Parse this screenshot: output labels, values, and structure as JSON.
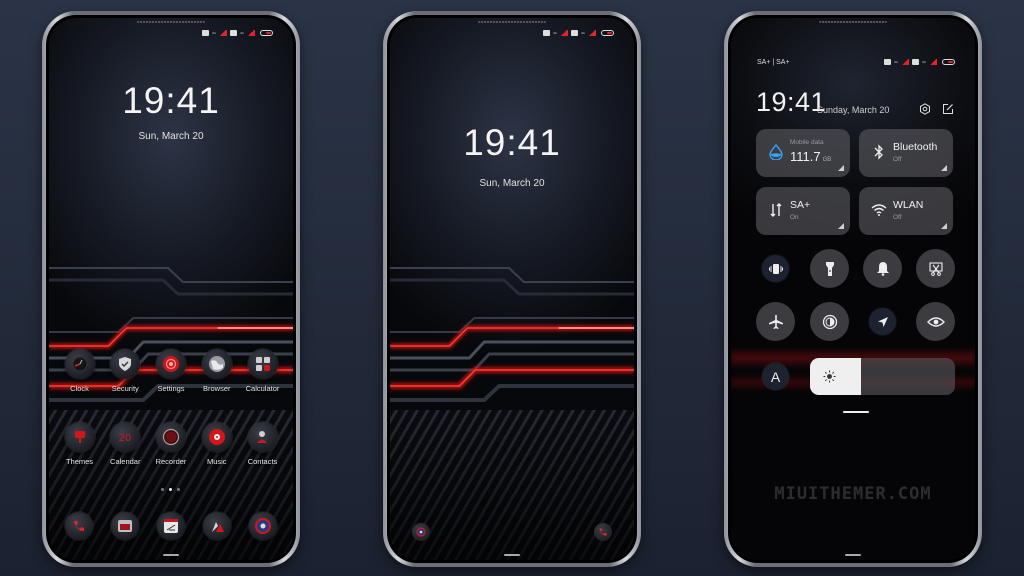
{
  "colors": {
    "accent_red": "#e0252a",
    "background": "#2b3447",
    "tile_bg": "#5a5a5f",
    "water_blue": "#3aa0f0"
  },
  "status_bar": {
    "sim1_network": "4G",
    "sim2_network": "4G",
    "icons": [
      "sim-icon",
      "signal-icon",
      "sim-icon",
      "signal-icon",
      "battery-icon"
    ]
  },
  "home_screen": {
    "time": "19:41",
    "date": "Sun, March 20",
    "row1": [
      {
        "label": "Clock",
        "icon": "clock-icon"
      },
      {
        "label": "Security",
        "icon": "shield-icon"
      },
      {
        "label": "Settings",
        "icon": "settings-icon"
      },
      {
        "label": "Browser",
        "icon": "globe-icon"
      },
      {
        "label": "Calculator",
        "icon": "calculator-icon"
      }
    ],
    "row2": [
      {
        "label": "Themes",
        "icon": "brush-icon"
      },
      {
        "label": "Calendar",
        "icon": "calendar-icon"
      },
      {
        "label": "Recorder",
        "icon": "record-icon"
      },
      {
        "label": "Music",
        "icon": "music-icon"
      },
      {
        "label": "Contacts",
        "icon": "contacts-icon"
      }
    ],
    "page_count": 3,
    "active_page": 2,
    "dock": [
      {
        "name": "phone",
        "icon": "phone-icon"
      },
      {
        "name": "messages",
        "icon": "messages-icon"
      },
      {
        "name": "notes",
        "icon": "notes-icon"
      },
      {
        "name": "gallery",
        "icon": "gallery-icon"
      },
      {
        "name": "camera",
        "icon": "camera-icon"
      }
    ]
  },
  "lock_screen": {
    "time": "19:41",
    "date": "Sun, March 20",
    "left_shortcut": "camera-icon",
    "right_shortcut": "phone-icon"
  },
  "control_center": {
    "carrier": "SA+ | SA+",
    "time": "19:41",
    "date": "Sunday, March 20",
    "tiles": {
      "mobile_data": {
        "label": "Mobile data",
        "value": "111.7",
        "unit": "GB"
      },
      "bluetooth": {
        "title": "Bluetooth",
        "state": "Off"
      },
      "sa_plus": {
        "title": "SA+",
        "state": "On"
      },
      "wlan": {
        "title": "WLAN",
        "state": "Off"
      }
    },
    "toggles_row1": [
      "vibrate-icon",
      "flashlight-icon",
      "bell-icon",
      "screenshot-icon"
    ],
    "toggles_row2": [
      "airplane-icon",
      "dark-mode-icon",
      "location-icon",
      "eye-icon"
    ],
    "auto_brightness_label": "A",
    "brightness_level": 0.35
  },
  "watermark": "MIUITHEMER.COM"
}
